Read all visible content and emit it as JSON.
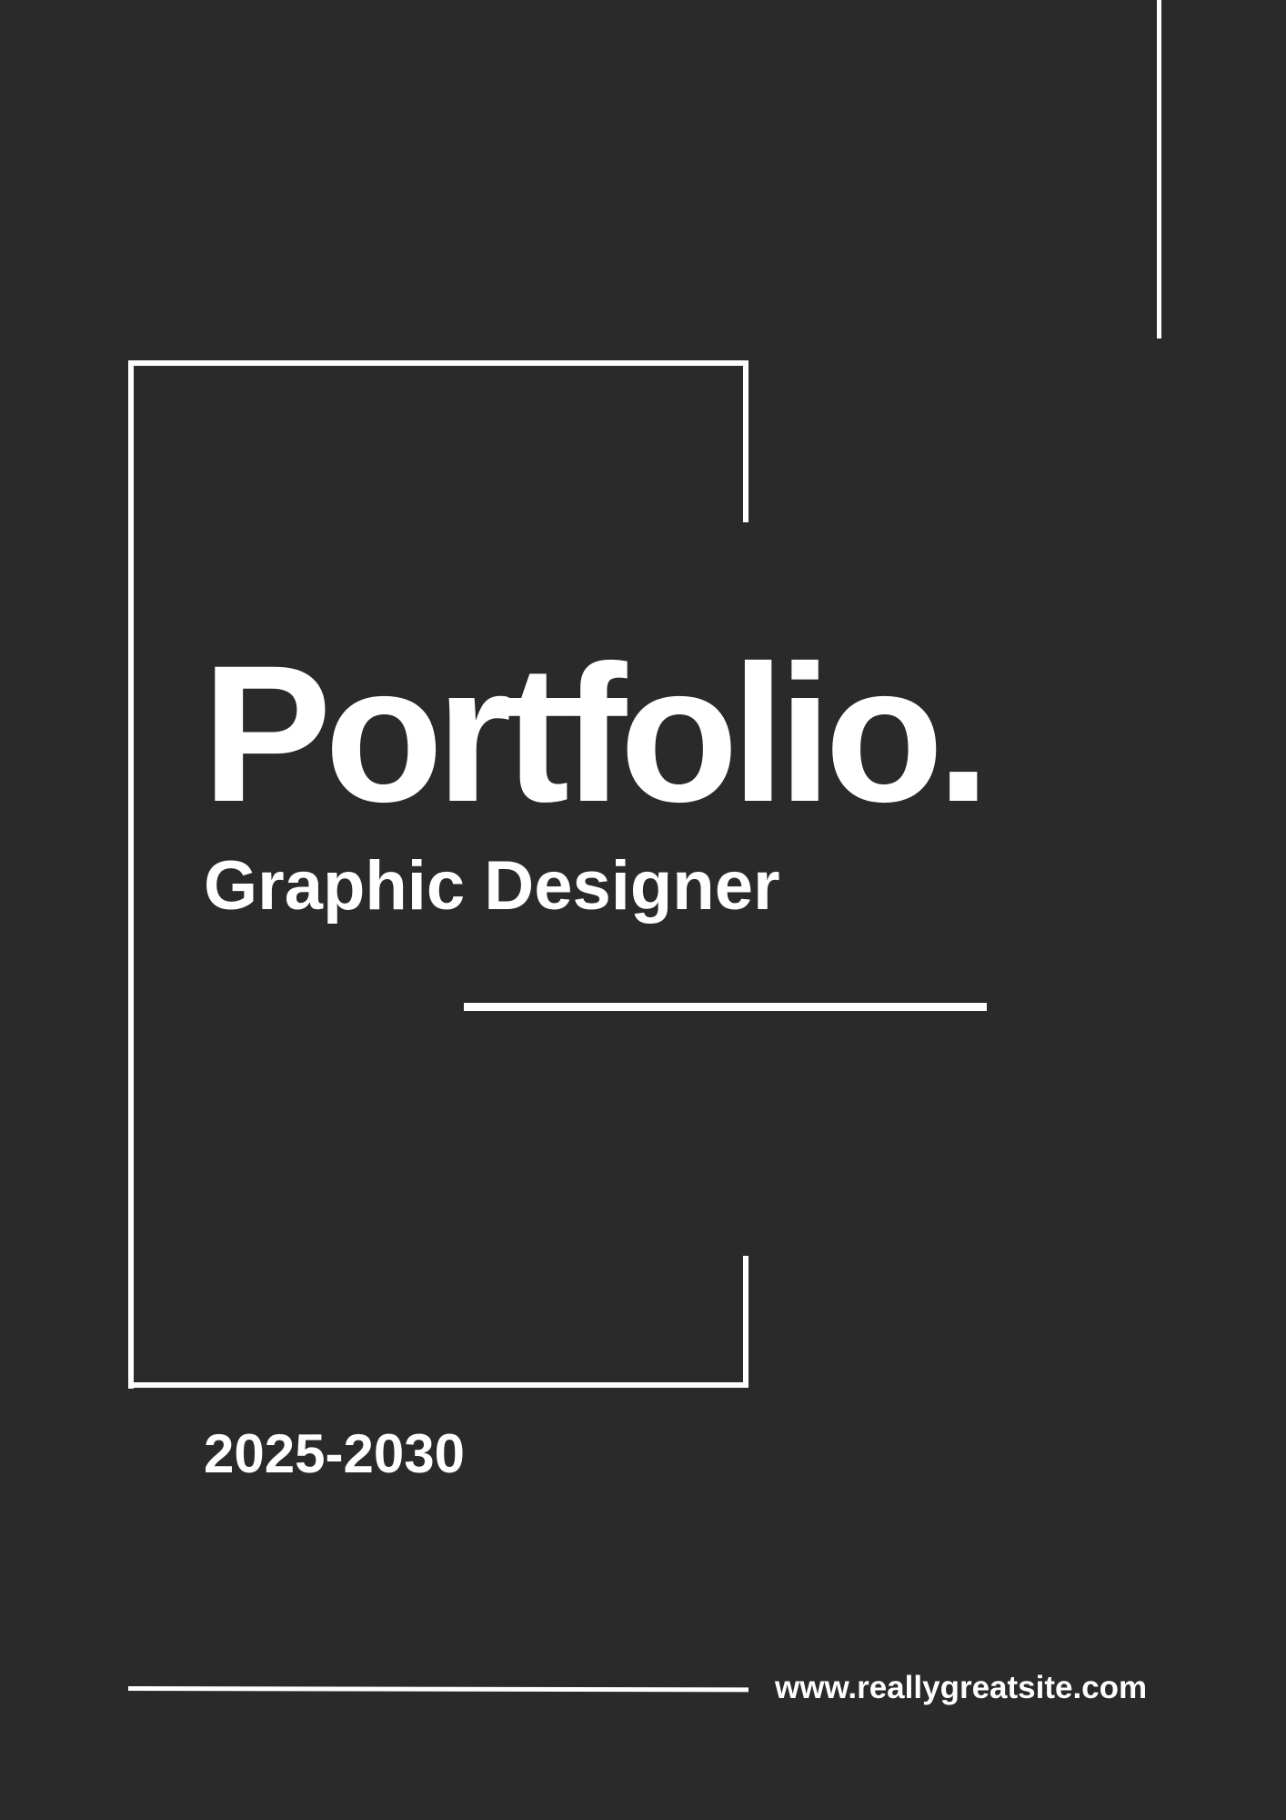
{
  "cover": {
    "title": "Portfolio.",
    "subtitle": "Graphic Designer",
    "years": "2025-2030",
    "website": "www.reallygreatsite.com"
  },
  "colors": {
    "background": "#2a2a2a",
    "foreground": "#ffffff"
  }
}
